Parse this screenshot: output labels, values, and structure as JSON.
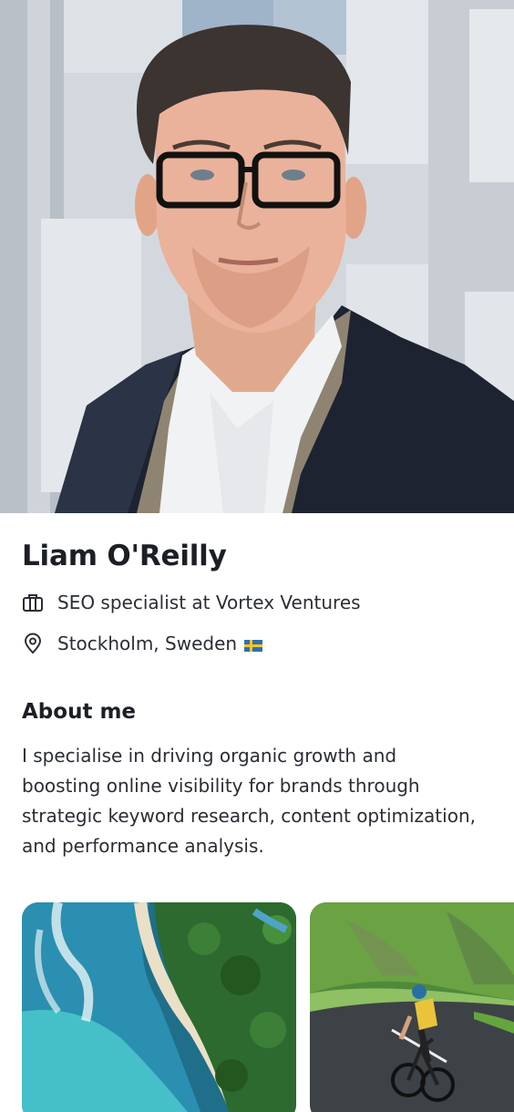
{
  "profile": {
    "name": "Liam O'Reilly",
    "job": "SEO specialist at Vortex Ventures",
    "location": "Stockholm, Sweden",
    "location_flag": "sweden-flag",
    "job_icon": "briefcase-icon",
    "location_icon": "map-pin-icon"
  },
  "about": {
    "heading": "About me",
    "text": "I specialise in driving organic growth and boosting online visibility for brands through strategic keyword research, content optimization, and performance analysis."
  },
  "colors": {
    "text_primary": "#1c1f24",
    "text_secondary": "#2a2e34",
    "flag_blue": "#2f6fb4",
    "flag_yellow": "#f6c626"
  },
  "gallery": {
    "items": [
      {
        "name": "beach-aerial-photo"
      },
      {
        "name": "road-cyclist-photo"
      }
    ]
  }
}
